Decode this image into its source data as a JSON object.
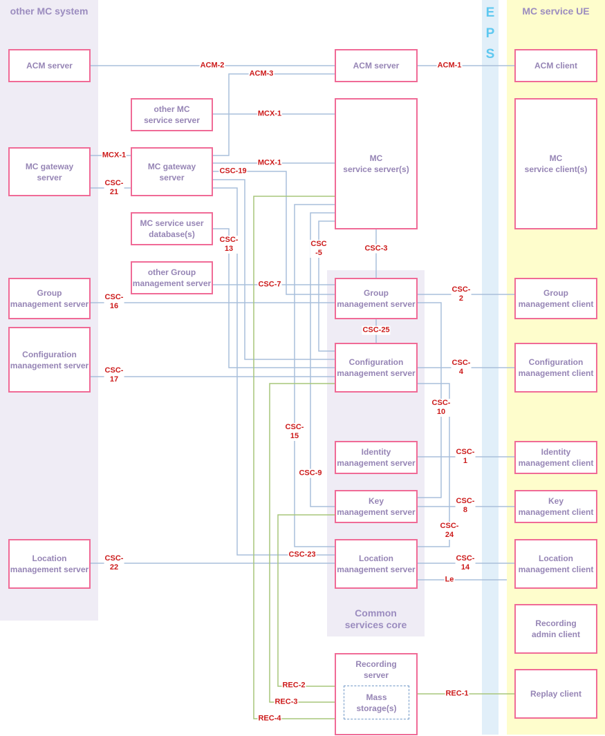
{
  "regions": {
    "other_mc_system": "other MC system",
    "eps": [
      "E",
      "P",
      "S"
    ],
    "mc_service_ue": "MC service UE",
    "common_services_core": "Common\nservices core"
  },
  "boxes": {
    "other_acm_server": "ACM server",
    "other_mc_gateway_server": "MC gateway\nserver",
    "other_group_mgmt_server": "Group\nmanagement server",
    "other_config_mgmt_server": "Configuration\nmanagement server",
    "other_location_mgmt_server": "Location\nmanagement server",
    "other_mc_service_server": "other MC\nservice server",
    "mc_gateway_server": "MC gateway\nserver",
    "mc_service_user_db": "MC service user\ndatabase(s)",
    "other_group_mgmt_server_mid": "other Group\nmanagement server",
    "acm_server": "ACM server",
    "mc_service_servers": "MC\nservice server(s)",
    "group_mgmt_server": "Group\nmanagement server",
    "config_mgmt_server": "Configuration\nmanagement server",
    "identity_mgmt_server": "Identity\nmanagement server",
    "key_mgmt_server": "Key\nmanagement server",
    "location_mgmt_server": "Location\nmanagement server",
    "recording_server": "Recording\nserver",
    "mass_storage": "Mass\nstorage(s)",
    "acm_client": "ACM client",
    "mc_service_clients": "MC\nservice client(s)",
    "group_mgmt_client": "Group\nmanagement client",
    "config_mgmt_client": "Configuration\nmanagement client",
    "identity_mgmt_client": "Identity\nmanagement client",
    "key_mgmt_client": "Key\nmanagement client",
    "location_mgmt_client": "Location\nmanagement client",
    "recording_admin_client": "Recording\nadmin client",
    "replay_client": "Replay client"
  },
  "interfaces": {
    "acm_2": "ACM-2",
    "acm_3": "ACM-3",
    "acm_1": "ACM-1",
    "mcx_1_other": "MCX-1",
    "mcx_1_gw_left": "MCX-1",
    "mcx_1_gw_right": "MCX-1",
    "csc_21": "CSC-\n21",
    "csc_19": "CSC-19",
    "csc_13": "CSC-\n13",
    "csc_5": "CSC\n-5",
    "csc_3": "CSC-3",
    "csc_7": "CSC-7",
    "csc_16": "CSC-\n16",
    "csc_2": "CSC-\n2",
    "csc_25": "CSC-25",
    "csc_17": "CSC-\n17",
    "csc_4": "CSC-\n4",
    "csc_10": "CSC-\n10",
    "csc_15": "CSC-\n15",
    "csc_1": "CSC-\n1",
    "csc_9": "CSC-9",
    "csc_8": "CSC-\n8",
    "csc_24": "CSC-\n24",
    "csc_23": "CSC-23",
    "csc_22": "CSC-\n22",
    "csc_14": "CSC-\n14",
    "le": "Le",
    "rec_2": "REC-2",
    "rec_3": "REC-3",
    "rec_4": "REC-4",
    "rec_1": "REC-1"
  },
  "colors": {
    "box_border": "#f06a96",
    "box_text": "#9685b5",
    "interface_label": "#cc1a1a",
    "csc_line": "#a9bfdb",
    "rec_line": "#a7c57a",
    "other_system_bg": "#efecf5",
    "eps_bg": "#e1eff9",
    "ue_bg": "#fefdcc"
  }
}
